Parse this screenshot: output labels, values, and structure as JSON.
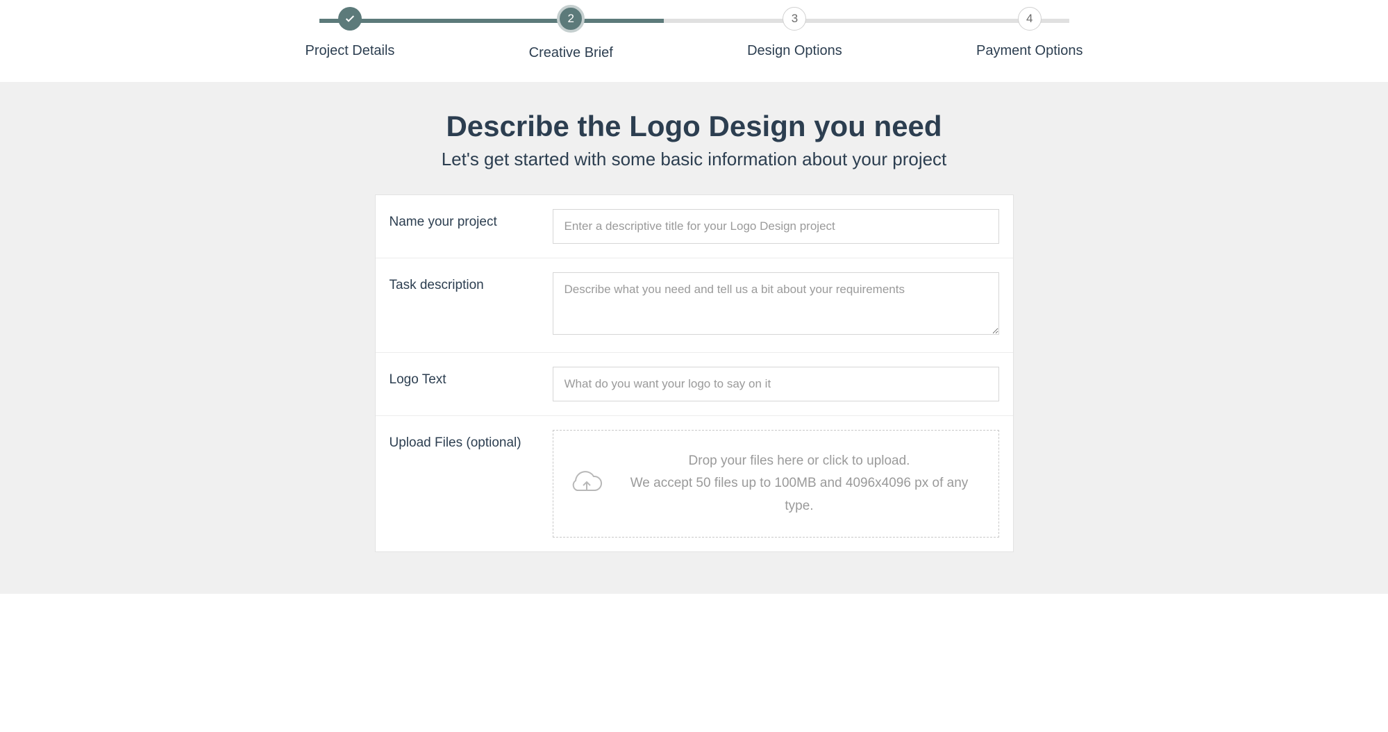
{
  "stepper": {
    "steps": [
      {
        "label": "Project Details",
        "state": "done"
      },
      {
        "label": "Creative Brief",
        "number": "2",
        "state": "active"
      },
      {
        "label": "Design Options",
        "number": "3",
        "state": "pending"
      },
      {
        "label": "Payment Options",
        "number": "4",
        "state": "pending"
      }
    ]
  },
  "page": {
    "title": "Describe the Logo Design you need",
    "subtitle": "Let's get started with some basic information about your project"
  },
  "form": {
    "project_name": {
      "label": "Name your project",
      "placeholder": "Enter a descriptive title for your Logo Design project",
      "value": ""
    },
    "task_description": {
      "label": "Task description",
      "placeholder": "Describe what you need and tell us a bit about your requirements",
      "value": ""
    },
    "logo_text": {
      "label": "Logo Text",
      "placeholder": "What do you want your logo to say on it",
      "value": ""
    },
    "upload": {
      "label": "Upload Files (optional)",
      "drop_prompt": "Drop your files here or click to upload.",
      "accept_note": "We accept 50 files up to 100MB and 4096x4096 px of any type."
    }
  }
}
